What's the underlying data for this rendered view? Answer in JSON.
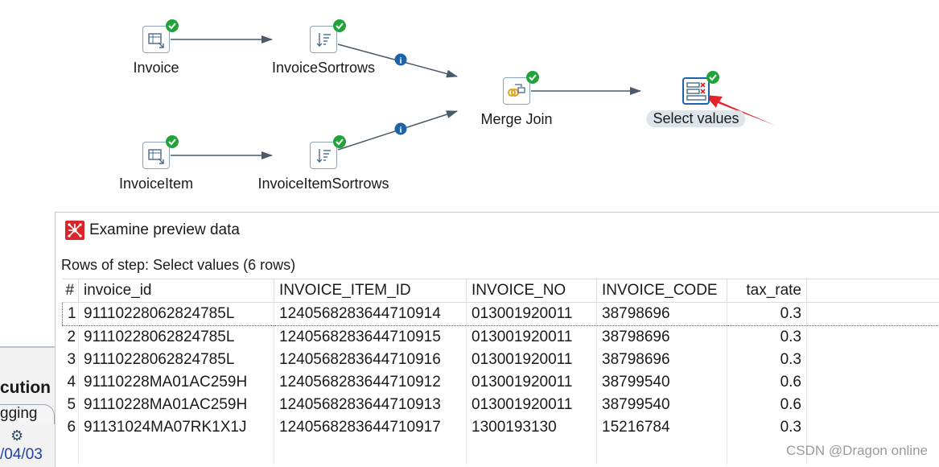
{
  "canvas": {
    "steps": {
      "invoice": "Invoice",
      "invoice_sortrows": "InvoiceSortrows",
      "merge_join": "Merge Join",
      "select_values": "Select values",
      "invoice_item": "InvoiceItem",
      "invoice_item_sortrows": "InvoiceItemSortrows"
    },
    "status_icon": "check-icon",
    "hop_info_icon": "info-icon",
    "colors": {
      "check": "#22a33a",
      "info": "#1d63a8",
      "hop": "#4a5a6a",
      "arrow_annotation": "#e8202a"
    }
  },
  "background_panel": {
    "title_fragment": "cution",
    "tab_fragment": "gging",
    "date_fragment": "/04/03",
    "icon": "gear-icon"
  },
  "dialog": {
    "title": "Examine preview data",
    "rows_label": "Rows of step: Select values (6 rows)",
    "columns": [
      "#",
      "invoice_id",
      "INVOICE_ITEM_ID",
      "INVOICE_NO",
      "INVOICE_CODE",
      "tax_rate"
    ],
    "rows": [
      [
        "1",
        "91110228062824785L",
        "1240568283644710914",
        "013001920011",
        "38798696",
        "0.3"
      ],
      [
        "2",
        "91110228062824785L",
        "1240568283644710915",
        "013001920011",
        "38798696",
        "0.3"
      ],
      [
        "3",
        "91110228062824785L",
        "1240568283644710916",
        "013001920011",
        "38798696",
        "0.3"
      ],
      [
        "4",
        "91110228MA01AC259H",
        "1240568283644710912",
        "013001920011",
        "38799540",
        "0.6"
      ],
      [
        "5",
        "91110228MA01AC259H",
        "1240568283644710913",
        "013001920011",
        "38799540",
        "0.6"
      ],
      [
        "6",
        "91131024MA07RK1X1J",
        "1240568283644710917",
        "1300193130",
        "15216784",
        "0.3"
      ]
    ]
  },
  "watermark": "CSDN @Dragon online"
}
